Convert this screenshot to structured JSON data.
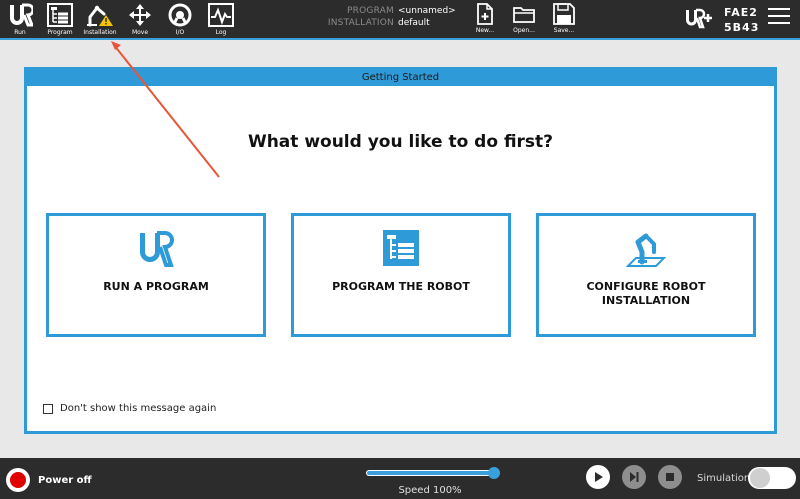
{
  "header": {
    "tools": [
      {
        "label": "Run",
        "icon": "ur-logo-icon"
      },
      {
        "label": "Program",
        "icon": "program-icon"
      },
      {
        "label": "Installation",
        "icon": "installation-icon"
      },
      {
        "label": "Move",
        "icon": "move-icon"
      },
      {
        "label": "I/O",
        "icon": "io-icon"
      },
      {
        "label": "Log",
        "icon": "log-icon"
      }
    ],
    "program_key": "PROGRAM",
    "program_value": "<unnamed>",
    "installation_key": "INSTALLATION",
    "installation_value": "default",
    "file_actions": [
      {
        "label": "New...",
        "icon": "new-file-icon"
      },
      {
        "label": "Open...",
        "icon": "open-folder-icon"
      },
      {
        "label": "Save...",
        "icon": "save-icon"
      }
    ],
    "serial_line1": "FAE2",
    "serial_line2": "5B43"
  },
  "dialog": {
    "title": "Getting Started",
    "question": "What would you like to do first?",
    "options": [
      {
        "label": "RUN A PROGRAM",
        "icon": "ur-logo-icon"
      },
      {
        "label": "PROGRAM THE ROBOT",
        "icon": "program-icon"
      },
      {
        "label": "CONFIGURE ROBOT INSTALLATION",
        "icon": "robot-arm-icon"
      }
    ],
    "dont_show_label": "Don't show this message again",
    "dont_show_checked": false
  },
  "footer": {
    "power_label": "Power off",
    "speed_label": "Speed 100%",
    "speed_value": 100,
    "simulation_label": "Simulation",
    "simulation_on": false
  },
  "colors": {
    "accent": "#2e9ad8",
    "header_bg": "#2c2c2c",
    "annotation_arrow": "#e8553a",
    "power_red": "#e00000",
    "warning": "#f5c400"
  }
}
